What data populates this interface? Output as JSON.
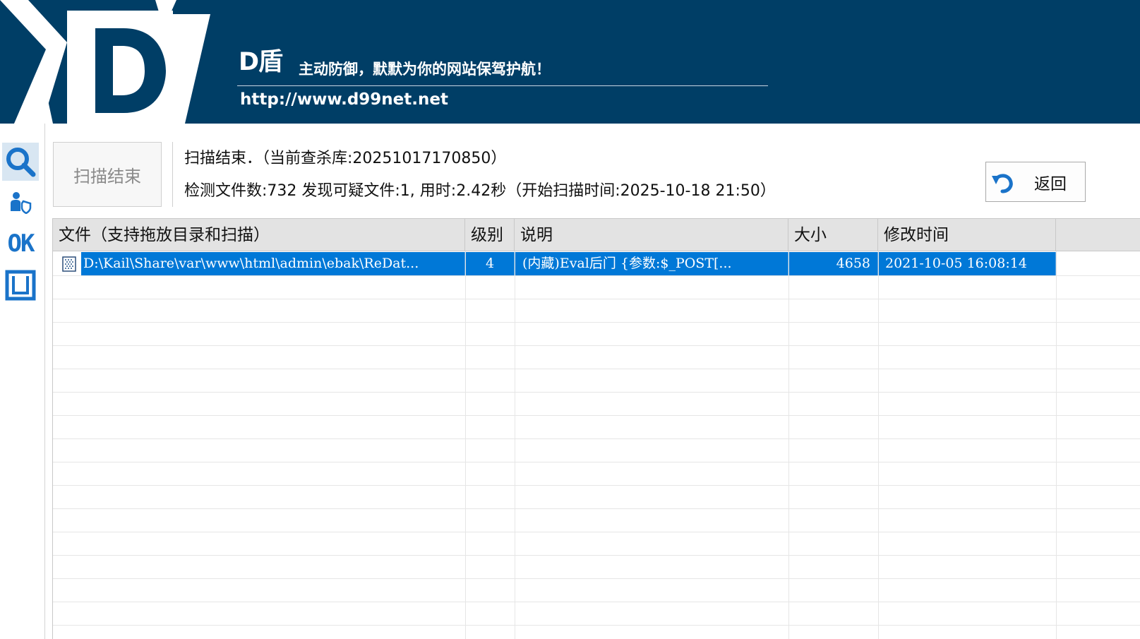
{
  "header": {
    "brand": "D盾",
    "slogan": "主动防御，默默为你的网站保驾护航！",
    "url": "http://www.d99net.net"
  },
  "sidebar": {
    "items": [
      {
        "name": "scan",
        "icon": "magnifier-icon"
      },
      {
        "name": "protect",
        "icon": "user-shield-icon"
      },
      {
        "name": "ok",
        "label": "OK"
      },
      {
        "name": "window",
        "icon": "window-icon"
      }
    ]
  },
  "status": {
    "state_label": "扫描结束",
    "line1": "扫描结束．（当前查杀库:20251017170850）",
    "line2": "检测文件数:732 发现可疑文件:1, 用时:2.42秒（开始扫描时间:2025-10-18 21:50）"
  },
  "back_button": {
    "label": "返回",
    "icon": "undo-arrow-icon"
  },
  "table": {
    "columns": [
      "文件（支持拖放目录和扫描）",
      "级别",
      "说明",
      "大小",
      "修改时间"
    ],
    "rows": [
      {
        "file": "D:\\Kail\\Share\\var\\www\\html\\admin\\ebak\\ReDat...",
        "level": "4",
        "description": "(内藏)Eval后门 {参数:$_POST[...",
        "size": "4658",
        "modified": "2021-10-05 16:08:14",
        "selected": true
      }
    ]
  },
  "colors": {
    "header_bg": "#003e66",
    "selection": "#0078d7",
    "icon_blue": "#1a73c9"
  }
}
